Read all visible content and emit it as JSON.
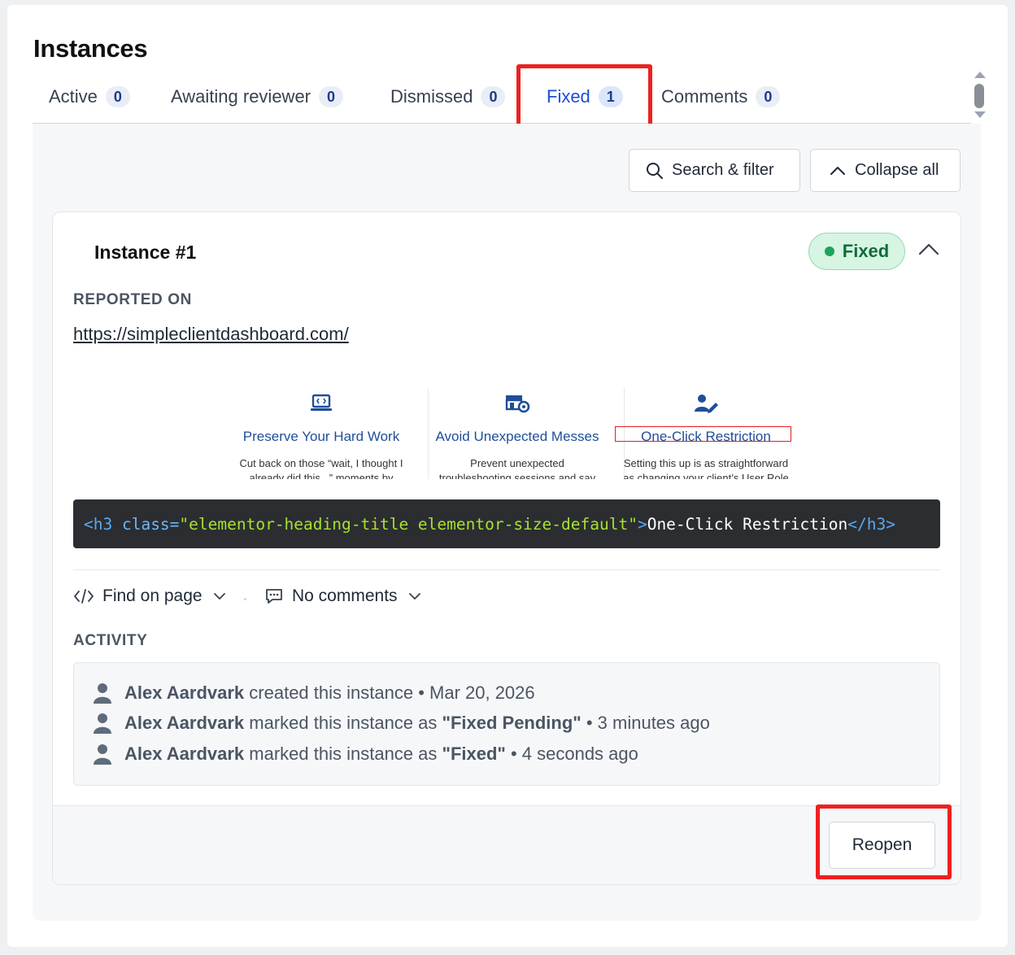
{
  "page_title": "Instances",
  "tabs": [
    {
      "label": "Active",
      "count": "0"
    },
    {
      "label": "Awaiting reviewer",
      "count": "0"
    },
    {
      "label": "Dismissed",
      "count": "0"
    },
    {
      "label": "Fixed",
      "count": "1"
    },
    {
      "label": "Comments",
      "count": "0"
    }
  ],
  "active_tab": "Fixed",
  "toolbar": {
    "search_label": "Search & filter",
    "collapse_label": "Collapse all"
  },
  "instance": {
    "title": "Instance #1",
    "status": "Fixed",
    "reported_on_label": "REPORTED ON",
    "url": "https://simpleclientdashboard.com/",
    "preview": [
      {
        "icon": "laptop-code-icon",
        "heading": "Preserve Your Hard Work",
        "body_line1": "Cut back on those “wait, I thought I",
        "body_line2": "already did this...” moments by"
      },
      {
        "icon": "store-gear-icon",
        "heading": "Avoid Unexpected Messes",
        "body_line1": "Prevent unexpected",
        "body_line2": "troubleshooting sessions and sav"
      },
      {
        "icon": "user-edit-icon",
        "heading": "One-Click Restriction",
        "body_line1": "Setting this up is as straightforward",
        "body_line2": "as changing your client’s User Role"
      }
    ],
    "code": {
      "open_tag": "<h3",
      "attr_name": " class=",
      "attr_value": "\"elementor-heading-title elementor-size-default\"",
      "open_close": ">",
      "text": "One-Click Restriction",
      "close_tag": "</h3>"
    },
    "find_on_page_label": "Find on page",
    "comments_label": "No comments",
    "activity_label": "ACTIVITY",
    "activity": [
      {
        "user": "Alex Aardvark",
        "text": " created this instance",
        "status": "",
        "time": " • Mar 20, 2026"
      },
      {
        "user": "Alex Aardvark",
        "text": " marked this instance as ",
        "status": "\"Fixed Pending\"",
        "time": " • 3 minutes ago"
      },
      {
        "user": "Alex Aardvark",
        "text": " marked this instance as ",
        "status": "\"Fixed\"",
        "time": " • 4 seconds ago"
      }
    ],
    "reopen_label": "Reopen"
  },
  "colors": {
    "accent": "#1d4ed8",
    "fixed_badge_bg": "#d6f5e3",
    "fixed_badge_text": "#116b3c",
    "highlight_red": "#ee2020"
  }
}
